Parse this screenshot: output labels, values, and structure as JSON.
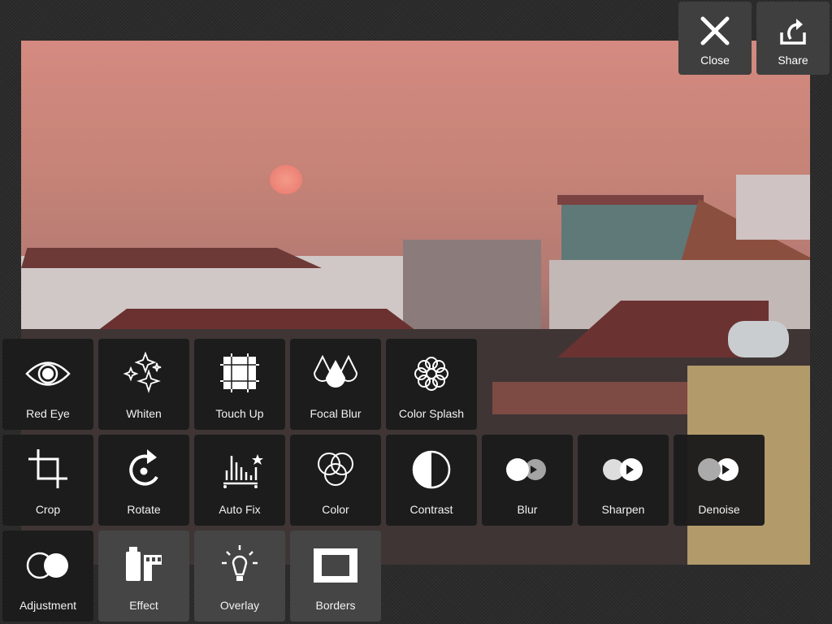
{
  "header": {
    "close_label": "Close",
    "share_label": "Share"
  },
  "tools": [
    {
      "label": "Red Eye",
      "icon": "eye-icon"
    },
    {
      "label": "Whiten",
      "icon": "sparkles-icon"
    },
    {
      "label": "Touch Up",
      "icon": "patch-icon"
    },
    {
      "label": "Focal Blur",
      "icon": "drops-icon"
    },
    {
      "label": "Color Splash",
      "icon": "flower-icon"
    },
    {
      "label": "Crop",
      "icon": "crop-icon"
    },
    {
      "label": "Rotate",
      "icon": "rotate-icon"
    },
    {
      "label": "Auto Fix",
      "icon": "histogram-star-icon"
    },
    {
      "label": "Color",
      "icon": "rgb-circles-icon"
    },
    {
      "label": "Contrast",
      "icon": "contrast-icon"
    },
    {
      "label": "Blur",
      "icon": "blur-icon"
    },
    {
      "label": "Sharpen",
      "icon": "sharpen-icon"
    },
    {
      "label": "Denoise",
      "icon": "denoise-icon"
    },
    {
      "label": "Adjustment",
      "icon": "adjustment-icon"
    },
    {
      "label": "Effect",
      "icon": "film-icon"
    },
    {
      "label": "Overlay",
      "icon": "lightbulb-icon"
    },
    {
      "label": "Borders",
      "icon": "frame-icon"
    }
  ]
}
